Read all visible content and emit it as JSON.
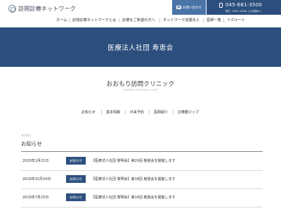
{
  "header": {
    "logo_text": "訪問診療ネットワーク",
    "contact_label": "お問い合わせ",
    "phone_number": "045-681-3500",
    "phone_hours": "受付：9:00～18:00（土日祝除く）",
    "nav": [
      {
        "label": "ホーム"
      },
      {
        "label": "訪問診療ネットワークとは"
      },
      {
        "label": "診療をご希望の方へ"
      },
      {
        "label": "ネットワーク加盟法人"
      },
      {
        "label": "医師一覧"
      },
      {
        "label": "リクルート"
      }
    ]
  },
  "banner": {
    "title": "医療法人社団 寿恵会"
  },
  "clinic": {
    "name": "おおもり訪問クリニック",
    "romaji": "OHMORI HOUMON CLINIC",
    "subnav": [
      {
        "label": "お知らせ"
      },
      {
        "label": "基本情報"
      },
      {
        "label": "外来予約"
      },
      {
        "label": "医師紹介"
      },
      {
        "label": "診療圏マップ"
      }
    ]
  },
  "news": {
    "eyebrow": "NEWS",
    "heading": "お知らせ",
    "items": [
      {
        "date": "2020年1月21日",
        "badge": "お知らせ",
        "title": "【医療法人社団 黎明会】第20回 勉強会を開催します"
      },
      {
        "date": "2019年10月24日",
        "badge": "お知らせ",
        "title": "【医療法人社団 黎明会】第18回 勉強会を開催します"
      },
      {
        "date": "2019年7月25日",
        "badge": "お知らせ",
        "title": "【医療法人社団 黎明会】第16回 勉強会を開催します"
      }
    ]
  },
  "colors": {
    "primary": "#2c4f7e",
    "contact": "#4a74a8"
  }
}
